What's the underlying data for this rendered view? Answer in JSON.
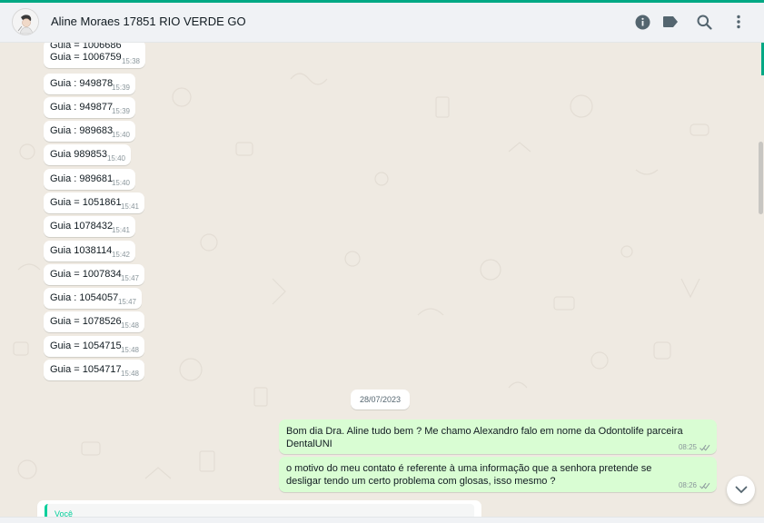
{
  "header": {
    "contact_name": "Aline Moraes 17851 RIO VERDE GO",
    "icons": [
      "info-icon",
      "label-icon",
      "search-icon",
      "menu-icon"
    ]
  },
  "colors": {
    "accent": "#00a884",
    "incoming_bubble": "#ffffff",
    "outgoing_bubble": "#d9fdd3",
    "chat_bg": "#efeae2"
  },
  "incoming_messages": [
    {
      "lines": [
        "Guia = 1006686",
        "Guia = 1006759"
      ],
      "time": "15:38"
    },
    {
      "text": "Guia : 949878",
      "time": "15:39"
    },
    {
      "text": "Guia : 949877",
      "time": "15:39"
    },
    {
      "text": "Guia : 989683",
      "time": "15:40"
    },
    {
      "text": "Guia 989853",
      "time": "15:40"
    },
    {
      "text": "Guia : 989681",
      "time": "15:40"
    },
    {
      "text": "Guia = 1051861",
      "time": "15:41"
    },
    {
      "text": "Guia 1078432",
      "time": "15:41"
    },
    {
      "text": "Guia 1038114",
      "time": "15:42"
    },
    {
      "text": "Guia = 1007834",
      "time": "15:47"
    },
    {
      "text": "Guia : 1054057",
      "time": "15:47"
    },
    {
      "text": "Guia = 1078526",
      "time": "15:48"
    },
    {
      "text": "Guia = 1054715",
      "time": "15:48"
    },
    {
      "text": "Guia = 1054717",
      "time": "15:48"
    }
  ],
  "date_separator": "28/07/2023",
  "outgoing_messages": [
    {
      "text": "Bom dia Dra. Aline tudo bem ? Me chamo Alexandro falo em nome da Odontolife parceira DentalUNI",
      "time": "08:25"
    },
    {
      "text": "o motivo do meu contato é referente à uma informação que a senhora pretende se desligar tendo um certo problema com glosas, isso mesmo ?",
      "time": "08:26"
    }
  ],
  "reply_preview": {
    "author": "Você"
  }
}
